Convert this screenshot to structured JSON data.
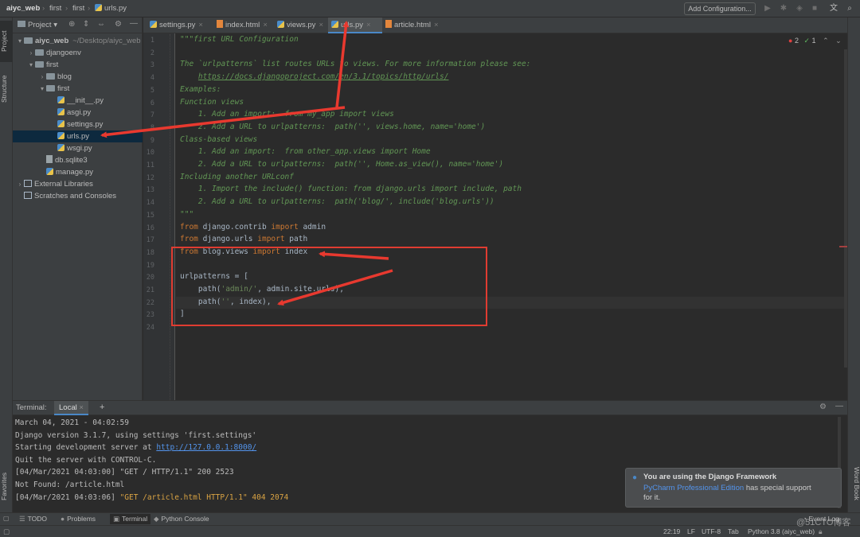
{
  "breadcrumb": [
    "aiyc_web",
    "first",
    "first",
    "urls.py"
  ],
  "toolbar": {
    "add_config": "Add Configuration..."
  },
  "left_strip": {
    "project": "Project",
    "structure": "Structure",
    "favorites": "Favorites"
  },
  "right_strip": {
    "word_book": "Word Book"
  },
  "project_panel": {
    "title": "Project"
  },
  "tree": [
    {
      "label": "aiyc_web",
      "suffix": "~/Desktop/aiyc_web",
      "type": "dir",
      "arrow": "▾",
      "indent": 0
    },
    {
      "label": "djangoenv",
      "type": "dir",
      "arrow": "›",
      "indent": 1
    },
    {
      "label": "first",
      "type": "dir",
      "arrow": "▾",
      "indent": 1
    },
    {
      "label": "blog",
      "type": "dir",
      "arrow": "›",
      "indent": 2
    },
    {
      "label": "first",
      "type": "dir",
      "arrow": "▾",
      "indent": 2
    },
    {
      "label": "__init__.py",
      "type": "py",
      "indent": 3
    },
    {
      "label": "asgi.py",
      "type": "py",
      "indent": 3
    },
    {
      "label": "settings.py",
      "type": "py",
      "indent": 3
    },
    {
      "label": "urls.py",
      "type": "py",
      "indent": 3,
      "selected": true
    },
    {
      "label": "wsgi.py",
      "type": "py",
      "indent": 3
    },
    {
      "label": "db.sqlite3",
      "type": "file",
      "indent": 2
    },
    {
      "label": "manage.py",
      "type": "py",
      "indent": 2
    },
    {
      "label": "External Libraries",
      "type": "lib",
      "arrow": "›",
      "indent": 0
    },
    {
      "label": "Scratches and Consoles",
      "type": "lib",
      "indent": 0
    }
  ],
  "tabs": [
    {
      "label": "settings.py",
      "active": false
    },
    {
      "label": "index.html",
      "active": false
    },
    {
      "label": "views.py",
      "active": false
    },
    {
      "label": "urls.py",
      "active": true
    },
    {
      "label": "article.html",
      "active": false
    }
  ],
  "inspections": {
    "errors": "2",
    "warnings": "1"
  },
  "code_lines": [
    [
      [
        "doc",
        "\"\"\"first URL Configuration"
      ]
    ],
    [],
    [
      [
        "doc",
        "The `urlpatterns` list routes URLs to views. For more information please see:"
      ]
    ],
    [
      [
        "doc",
        "    "
      ],
      [
        "lnk",
        "https://docs.djangoproject.com/en/3.1/topics/http/urls/"
      ]
    ],
    [
      [
        "doc",
        "Examples:"
      ]
    ],
    [
      [
        "doc",
        "Function views"
      ]
    ],
    [
      [
        "doc",
        "    1. Add an import:  from my_app import views"
      ]
    ],
    [
      [
        "doc",
        "    2. Add a URL to urlpatterns:  path('', views.home, name='home')"
      ]
    ],
    [
      [
        "doc",
        "Class-based views"
      ]
    ],
    [
      [
        "doc",
        "    1. Add an import:  from other_app.views import Home"
      ]
    ],
    [
      [
        "doc",
        "    2. Add a URL to urlpatterns:  path('', Home.as_view(), name='home')"
      ]
    ],
    [
      [
        "doc",
        "Including another URLconf"
      ]
    ],
    [
      [
        "doc",
        "    1. Import the include() function: from django.urls import include, path"
      ]
    ],
    [
      [
        "doc",
        "    2. Add a URL to urlpatterns:  path('blog/', include('blog.urls'))"
      ]
    ],
    [
      [
        "doc",
        "\"\"\""
      ]
    ],
    [
      [
        "kw",
        "from"
      ],
      [
        "pl",
        " django.contrib "
      ],
      [
        "kw",
        "import"
      ],
      [
        "pl",
        " admin"
      ]
    ],
    [
      [
        "kw",
        "from"
      ],
      [
        "pl",
        " django.urls "
      ],
      [
        "kw",
        "import"
      ],
      [
        "pl",
        " path"
      ]
    ],
    [
      [
        "kw",
        "from"
      ],
      [
        "pl",
        " blog.views "
      ],
      [
        "kw",
        "import"
      ],
      [
        "pl",
        " index"
      ]
    ],
    [],
    [
      [
        "pl",
        "urlpatterns = ["
      ]
    ],
    [
      [
        "pl",
        "    path("
      ],
      [
        "str",
        "'admin/'"
      ],
      [
        "pl",
        ", admin.site.urls),"
      ]
    ],
    [
      [
        "pl",
        "    path("
      ],
      [
        "str",
        "''"
      ],
      [
        "pl",
        ", index),"
      ]
    ],
    [
      [
        "pl",
        "]"
      ]
    ],
    []
  ],
  "terminal": {
    "title": "Terminal:",
    "tab": "Local",
    "lines": [
      [
        [
          "n",
          "March 04, 2021 - 04:02:59"
        ]
      ],
      [
        [
          "n",
          "Django version 3.1.7, using settings 'first.settings'"
        ]
      ],
      [
        [
          "n",
          "Starting development server at "
        ],
        [
          "lnk",
          "http://127.0.0.1:8000/"
        ]
      ],
      [
        [
          "n",
          "Quit the server with CONTROL-C."
        ]
      ],
      [
        [
          "n",
          "[04/Mar/2021 04:03:00] \"GET / HTTP/1.1\" 200 2523"
        ]
      ],
      [
        [
          "n",
          "Not Found: /article.html"
        ]
      ],
      [
        [
          "n",
          "[04/Mar/2021 04:03:06] "
        ],
        [
          "warn",
          "\"GET /article.html HTTP/1.1\" 404 2074"
        ]
      ]
    ]
  },
  "notification": {
    "title": "You are using the Django Framework",
    "link": "PyCharm Professional Edition",
    "rest": " has special support",
    "rest2": "for it."
  },
  "tool_windows": [
    {
      "label": "TODO",
      "icon": "☰"
    },
    {
      "label": "Problems",
      "icon": "●"
    },
    {
      "label": "Terminal",
      "icon": "▣",
      "active": true
    },
    {
      "label": "Python Console",
      "icon": "◆"
    }
  ],
  "event_log": "Event Log",
  "status": {
    "position": "22:19",
    "line_sep": "LF",
    "encoding": "UTF-8",
    "indent": "Tab",
    "interpreter": "Python 3.8 (aiyc_web)"
  },
  "watermark": "@51CTO博客"
}
